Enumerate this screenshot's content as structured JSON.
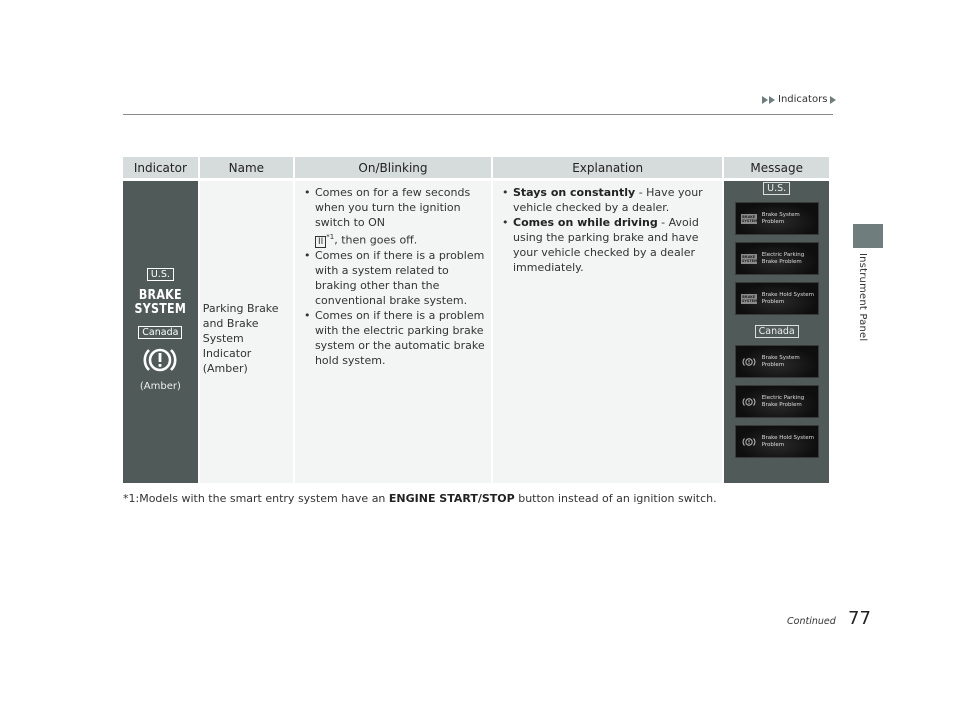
{
  "header": {
    "breadcrumb": "Indicators",
    "side_label": "Instrument Panel"
  },
  "table": {
    "columns": [
      "Indicator",
      "Name",
      "On/Blinking",
      "Explanation",
      "Message"
    ],
    "row": {
      "indicator": {
        "us_tag": "U.S.",
        "us_icon_text_line1": "BRAKE",
        "us_icon_text_line2": "SYSTEM",
        "canada_tag": "Canada",
        "canada_icon": "brake-warning-exclamation-icon",
        "color_label": "(Amber)"
      },
      "name": "Parking Brake and Brake System Indicator (Amber)",
      "on_blinking": {
        "item1_part1": "Comes on for a few seconds when you turn the ignition switch to ON",
        "item1_key": "II",
        "item1_sup": "*1",
        "item1_part2": ", then goes off.",
        "item2": "Comes on if there is a problem with a system related to braking other than the conventional brake system.",
        "item3": "Comes on if there is a problem with the electric parking brake system or the automatic brake hold system."
      },
      "explanation": [
        {
          "bold": "Stays on constantly",
          "text": " - Have your vehicle checked by a dealer."
        },
        {
          "bold": "Comes on while driving",
          "text": " - Avoid using the parking brake and have your vehicle checked by a dealer immediately."
        }
      ],
      "message": {
        "us_tag": "U.S.",
        "us_icon_text": "BRAKE SYSTEM",
        "us_messages": [
          "Brake System Problem",
          "Electric Parking Brake Problem",
          "Brake Hold System Problem"
        ],
        "canada_tag": "Canada",
        "canada_messages": [
          "Brake System Problem",
          "Electric Parking Brake Problem",
          "Brake Hold System Problem"
        ]
      }
    }
  },
  "footnote": {
    "prefix": "*1:Models with the smart entry system have an ",
    "bold": "ENGINE START/STOP",
    "suffix": " button instead of an ignition switch."
  },
  "footer": {
    "continued": "Continued",
    "page_number": "77"
  }
}
